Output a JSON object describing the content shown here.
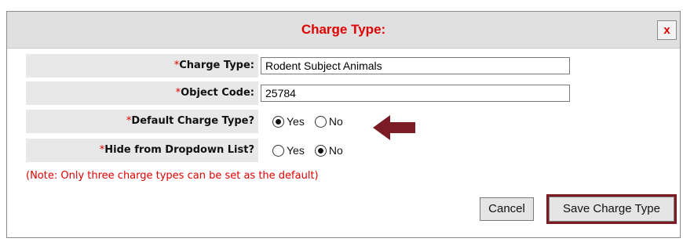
{
  "dialog": {
    "title": "Charge Type:",
    "close_label": "x"
  },
  "form": {
    "required_marker": "*",
    "charge_type": {
      "label": "Charge Type:",
      "value": "Rodent Subject Animals"
    },
    "object_code": {
      "label": "Object Code:",
      "value": "25784"
    },
    "default_charge_type": {
      "label": "Default Charge Type?",
      "options": [
        "Yes",
        "No"
      ],
      "selected": "Yes"
    },
    "hide_from_dropdown": {
      "label": "Hide from Dropdown List?",
      "options": [
        "Yes",
        "No"
      ],
      "selected": "No"
    },
    "note": "(Note: Only three charge types can be set as the default)"
  },
  "buttons": {
    "cancel": "Cancel",
    "save": "Save Charge Type"
  },
  "colors": {
    "title": "#e00000",
    "required": "#e00000",
    "highlight": "#7b1c25"
  },
  "icons": {
    "annotation_arrow": "left-arrow-icon"
  }
}
